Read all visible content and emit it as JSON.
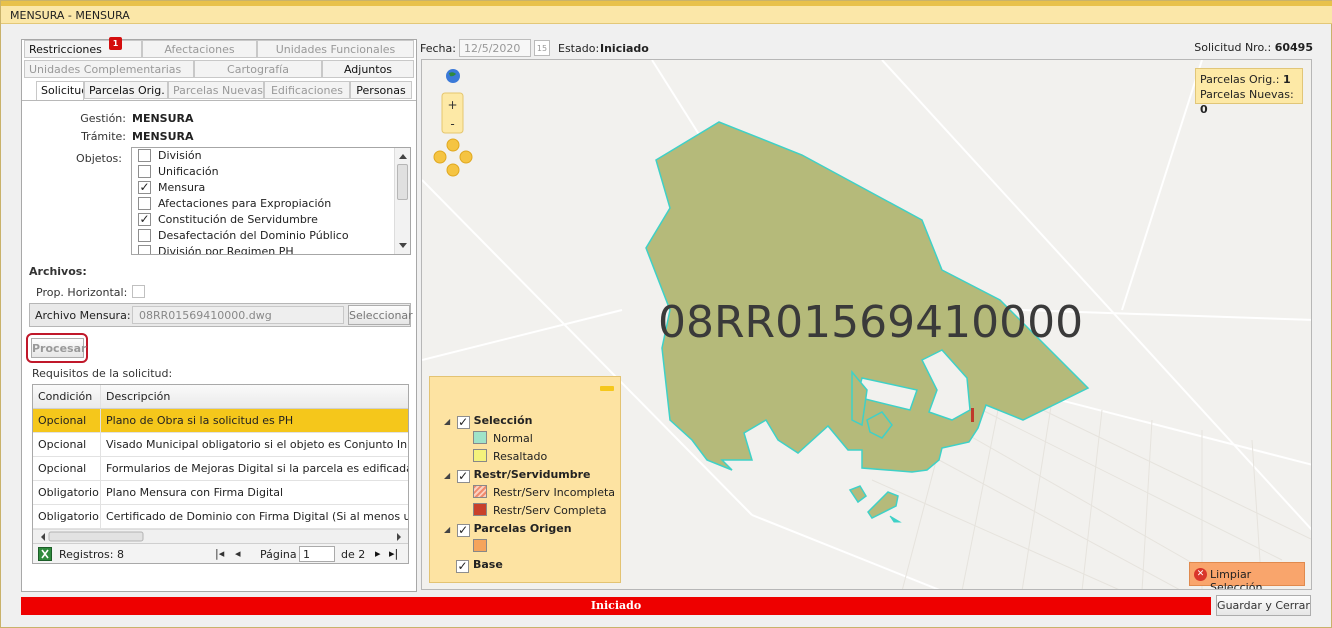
{
  "window": {
    "title": "MENSURA  -  MENSURA"
  },
  "colors": {
    "accent": "#f5c71b",
    "status": "#ee0000",
    "parcel_fill": "#b5ba7a",
    "parcel_stroke": "#3fd1c7"
  },
  "tabs_row1": [
    {
      "label": "Restricciones",
      "badge": "1"
    },
    {
      "label": "Afectaciones"
    },
    {
      "label": "Unidades Funcionales"
    }
  ],
  "tabs_row2": [
    {
      "label": "Unidades Complementarias"
    },
    {
      "label": "Cartografía"
    },
    {
      "label": "Adjuntos"
    }
  ],
  "tabs_row3": [
    {
      "label": "Solicitud"
    },
    {
      "label": "Parcelas Orig."
    },
    {
      "label": "Parcelas Nuevas"
    },
    {
      "label": "Edificaciones"
    },
    {
      "label": "Personas"
    }
  ],
  "solicitud": {
    "gestion_label": "Gestión:",
    "gestion_value": "MENSURA",
    "tramite_label": "Trámite:",
    "tramite_value": "MENSURA",
    "objetos_label": "Objetos:",
    "objetos": [
      {
        "label": "División",
        "checked": false
      },
      {
        "label": "Unificación",
        "checked": false
      },
      {
        "label": "Mensura",
        "checked": true
      },
      {
        "label": "Afectaciones para Expropiación",
        "checked": false
      },
      {
        "label": "Constitución de Servidumbre",
        "checked": true
      },
      {
        "label": "Desafectación del Dominio Público",
        "checked": false
      },
      {
        "label": "División por Regimen PH",
        "checked": false
      }
    ],
    "archivos_label": "Archivos:",
    "prop_horizontal_label": "Prop. Horizontal:",
    "archivo_mensura_label": "Archivo Mensura:",
    "archivo_mensura_value": "08RR01569410000.dwg",
    "seleccionar_label": "Seleccionar",
    "procesar_label": "Procesar",
    "requisitos_label": "Requisitos de la solicitud:"
  },
  "requisitos": {
    "headers": [
      "Condición",
      "Descripción"
    ],
    "rows": [
      [
        "Opcional",
        "Plano de Obra si la solicitud es PH"
      ],
      [
        "Opcional",
        "Visado Municipal obligatorio si el objeto es Conjunto Inmobi"
      ],
      [
        "Opcional",
        "Formularios de Mejoras Digital si la parcela es edificada"
      ],
      [
        "Obligatorio",
        "Plano Mensura con Firma Digital"
      ],
      [
        "Obligatorio",
        "Certificado de Dominio con Firma Digital (Si al menos una p"
      ]
    ],
    "registros": "Registros: 8",
    "pagina_label": "Página",
    "pagina_value": "1",
    "de_label": "de 2"
  },
  "header": {
    "fecha_label": "Fecha:",
    "fecha_value": "12/5/2020",
    "calendar_day": "15",
    "estado_label": "Estado:",
    "estado_value": "Iniciado",
    "solicitud_label": "Solicitud Nro.:",
    "solicitud_value": "60495"
  },
  "map": {
    "parcel_label": "08RR01569410000",
    "zoom_in": "+",
    "zoom_out": "-",
    "counter": {
      "orig_label": "Parcelas Orig.:",
      "orig_value": "1",
      "nuevas_label": "Parcelas Nuevas:",
      "nuevas_value": "0"
    },
    "legend": {
      "groups": [
        {
          "label": "Selección",
          "items": [
            {
              "label": "Normal",
              "color": "#9fe3c9"
            },
            {
              "label": "Resaltado",
              "color": "#f4f27c"
            }
          ]
        },
        {
          "label": "Restr/Servidumbre",
          "items": [
            {
              "label": "Restr/Serv Incompleta",
              "color": "#f08a6c"
            },
            {
              "label": "Restr/Serv Completa",
              "color": "#c8402a"
            }
          ]
        },
        {
          "label": "Parcelas Origen",
          "items": [
            {
              "label": "",
              "color": "#f5a45c"
            }
          ]
        },
        {
          "label": "Base",
          "items": []
        }
      ]
    },
    "limpiar_label": "Limpiar Selección"
  },
  "status": {
    "text": "Iniciado"
  },
  "footer": {
    "guardar_label": "Guardar y Cerrar"
  }
}
